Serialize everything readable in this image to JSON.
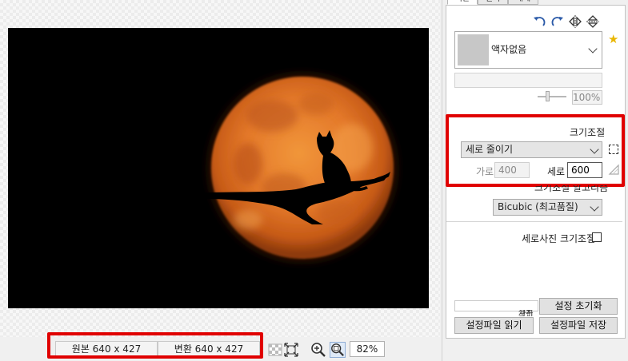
{
  "panel": {
    "tabs": [
      "기본",
      "필터",
      "개체"
    ],
    "frame": {
      "selected": "액자없음"
    },
    "opacity_value": "100%",
    "resize": {
      "title": "크기조절",
      "mode": "세로 줄이기",
      "width_label": "가로",
      "width_value": "400",
      "height_label": "세로",
      "height_value": "600"
    },
    "algorithm": {
      "title": "크기조절 알고리즘",
      "selected": "Bicubic (최고품질)"
    },
    "portrait_resize_label": "세로사진 크기조절",
    "buttons": {
      "reset": "설정 초기화",
      "load": "설정파일 읽기",
      "save": "설정파일 저장"
    }
  },
  "status": {
    "original_size": "원본 640 x 427",
    "converted_size": "변환 640 x 427",
    "zoom": "82%"
  },
  "colors": {
    "highlight": "#e00000",
    "moon": "#e9872b",
    "background": "#000000"
  }
}
